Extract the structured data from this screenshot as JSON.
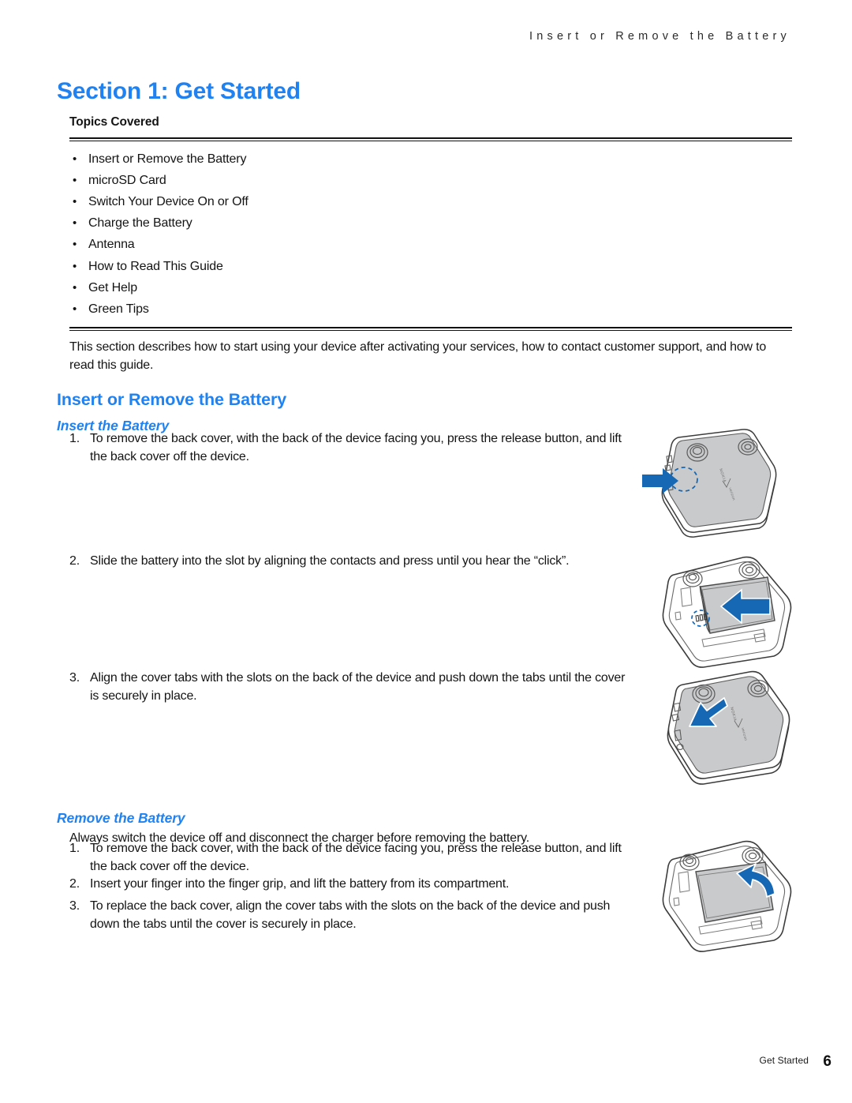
{
  "header": {
    "running_title": "Insert or Remove the Battery"
  },
  "section": {
    "title": "Section 1:  Get Started"
  },
  "topics": {
    "heading": "Topics Covered",
    "bullet_glyph": "•",
    "items": [
      "Insert or Remove the Battery",
      "microSD Card",
      "Switch Your Device On or Off",
      "Charge the Battery",
      "Antenna",
      "How to Read This Guide",
      "Get Help",
      "Green Tips"
    ]
  },
  "intro": {
    "text": "This section describes how to start using your device after activating your services, how to contact customer support, and how to read this guide."
  },
  "insert_remove": {
    "heading": "Insert or Remove the Battery",
    "insert": {
      "heading": "Insert the Battery",
      "steps": [
        {
          "num": "1.",
          "text": "To remove the back cover, with the back of the device facing you, press the release button, and lift the back cover off the device."
        },
        {
          "num": "2.",
          "text": "Slide the battery into the slot by aligning the contacts and press until you hear the “click”."
        },
        {
          "num": "3.",
          "text": "Align the cover tabs with the slots on the back of the device and push down the tabs until the cover is securely in place."
        }
      ]
    },
    "remove": {
      "heading": "Remove the Battery",
      "note": "Always switch the device off and disconnect the charger before removing the battery.",
      "steps": [
        {
          "num": "1.",
          "text": "To remove the back cover, with the back of the device facing you, press the release button, and lift the back cover off the device."
        },
        {
          "num": "2.",
          "text": "Insert your finger into the finger grip, and lift the battery from its compartment."
        },
        {
          "num": "3.",
          "text": "To replace the back cover, align the cover tabs with the slots on the back of the device and push down the tabs until the cover is securely in place."
        }
      ]
    }
  },
  "illustrations": {
    "brand_primary": "NOKIA",
    "brand_secondary": "verizon",
    "figure_1_caption": "device back cover with release button and arrow",
    "figure_2_caption": "battery sliding into compartment with arrow",
    "figure_3_caption": "back cover being replaced with arrow",
    "figure_4_caption": "battery being lifted from compartment with curved arrow"
  },
  "footer": {
    "label": "Get Started",
    "page_number": "6"
  },
  "colors": {
    "heading_blue": "#1f82f0",
    "arrow_blue": "#1668b4",
    "text_black": "#141414",
    "device_gray": "#c9cacc"
  }
}
